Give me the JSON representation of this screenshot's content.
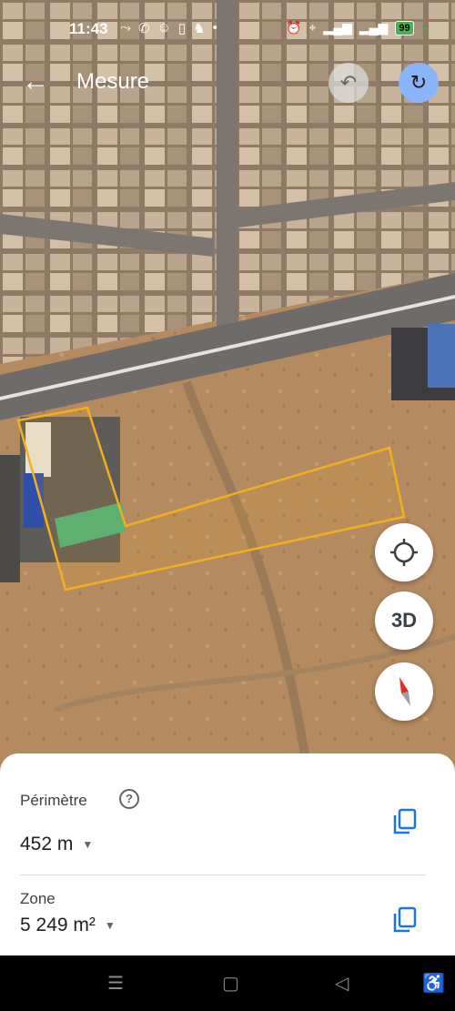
{
  "status_bar": {
    "time": "11:43",
    "left_icons": [
      "missed-call-icon",
      "whatsapp-icon",
      "chat-icon",
      "phone-icon",
      "snapchat-icon",
      "dot-icon"
    ],
    "right_icons": [
      "alarm-icon",
      "location-icon",
      "signal-icon",
      "signal-icon"
    ],
    "battery": "99"
  },
  "header": {
    "title": "Mesure",
    "back_icon": "arrow-left-icon",
    "undo_icon": "undo-icon",
    "redo_icon": "redo-icon"
  },
  "map_controls": {
    "locate_icon": "my-location-icon",
    "view_3d_label": "3D",
    "compass_icon": "compass-icon"
  },
  "measurement": {
    "perimeter_label": "Périmètre",
    "perimeter_value": "452 m",
    "area_label": "Zone",
    "area_value": "5 249 m²"
  },
  "colors": {
    "polygon": "#f2b01e",
    "accent": "#1a73e8"
  }
}
